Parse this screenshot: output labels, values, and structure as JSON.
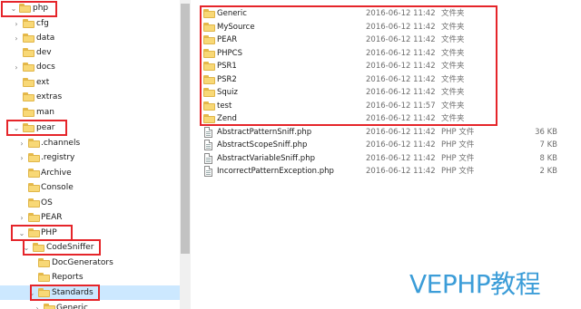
{
  "tree": {
    "items": [
      {
        "label": "php",
        "expanded": true
      },
      {
        "label": "cfg"
      },
      {
        "label": "data"
      },
      {
        "label": "dev"
      },
      {
        "label": "docs"
      },
      {
        "label": "ext"
      },
      {
        "label": "extras"
      },
      {
        "label": "man"
      },
      {
        "label": "pear",
        "expanded": true
      },
      {
        "label": ".channels"
      },
      {
        "label": ".registry"
      },
      {
        "label": "Archive"
      },
      {
        "label": "Console"
      },
      {
        "label": "OS"
      },
      {
        "label": "PEAR"
      },
      {
        "label": "PHP",
        "expanded": true
      },
      {
        "label": "CodeSniffer",
        "expanded": true
      },
      {
        "label": "DocGenerators"
      },
      {
        "label": "Reports"
      },
      {
        "label": "Standards",
        "expanded": true,
        "selected": true
      },
      {
        "label": "Generic"
      }
    ]
  },
  "list": {
    "folders": [
      {
        "name": "Generic",
        "date": "2016-06-12 11:42",
        "type": "文件夹"
      },
      {
        "name": "MySource",
        "date": "2016-06-12 11:42",
        "type": "文件夹"
      },
      {
        "name": "PEAR",
        "date": "2016-06-12 11:42",
        "type": "文件夹"
      },
      {
        "name": "PHPCS",
        "date": "2016-06-12 11:42",
        "type": "文件夹"
      },
      {
        "name": "PSR1",
        "date": "2016-06-12 11:42",
        "type": "文件夹"
      },
      {
        "name": "PSR2",
        "date": "2016-06-12 11:42",
        "type": "文件夹"
      },
      {
        "name": "Squiz",
        "date": "2016-06-12 11:42",
        "type": "文件夹"
      },
      {
        "name": "test",
        "date": "2016-06-12 11:57",
        "type": "文件夹"
      },
      {
        "name": "Zend",
        "date": "2016-06-12 11:42",
        "type": "文件夹"
      }
    ],
    "files": [
      {
        "name": "AbstractPatternSniff.php",
        "date": "2016-06-12 11:42",
        "type": "PHP 文件",
        "size": "36 KB"
      },
      {
        "name": "AbstractScopeSniff.php",
        "date": "2016-06-12 11:42",
        "type": "PHP 文件",
        "size": "7 KB"
      },
      {
        "name": "AbstractVariableSniff.php",
        "date": "2016-06-12 11:42",
        "type": "PHP 文件",
        "size": "8 KB"
      },
      {
        "name": "IncorrectPatternException.php",
        "date": "2016-06-12 11:42",
        "type": "PHP 文件",
        "size": "2 KB"
      }
    ]
  },
  "watermark": "VEPHP教程",
  "colors": {
    "highlight": "#e5252a",
    "selection": "#cce8ff",
    "folder": "#f8d876",
    "watermark": "#3c9dd8"
  }
}
